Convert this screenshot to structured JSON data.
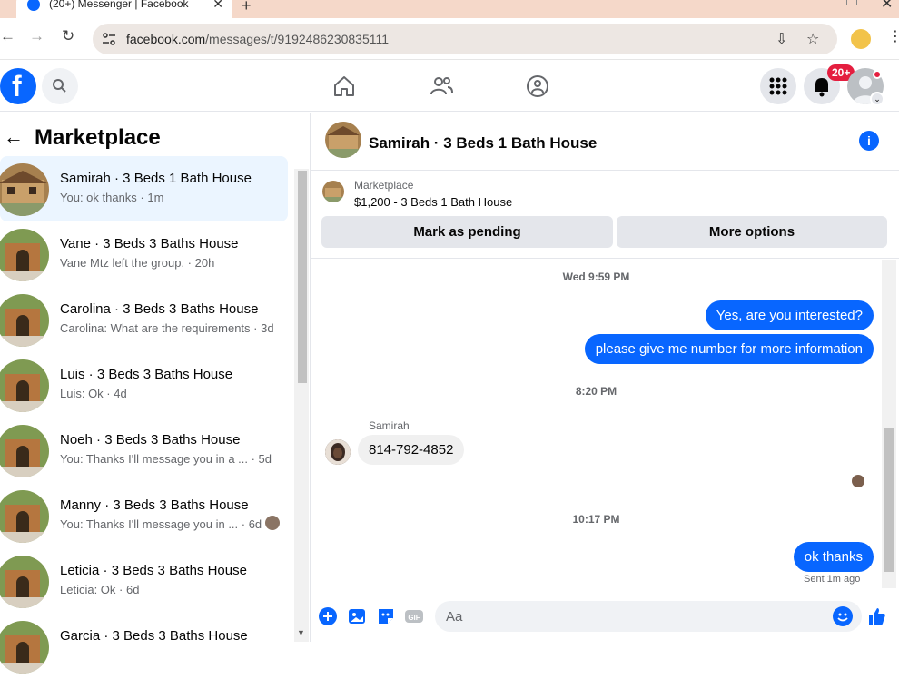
{
  "browser": {
    "tab_title": "(20+) Messenger | Facebook",
    "url_domain": "facebook.com",
    "url_path": "/messages/t/9192486230835111"
  },
  "header": {
    "notification_badge": "20+"
  },
  "sidebar": {
    "title": "Marketplace",
    "conversations": [
      {
        "name": "Samirah · 3 Beds 1 Bath House",
        "snippet": "You: ok thanks · 1m",
        "active": true
      },
      {
        "name": "Vane · 3 Beds 3 Baths House",
        "snippet": "Vane Mtz left the group. · 20h"
      },
      {
        "name": "Carolina · 3 Beds 3 Baths House",
        "snippet": "Carolina: What are the requirements · 3d"
      },
      {
        "name": "Luis · 3 Beds 3 Baths House",
        "snippet": "Luis: Ok · 4d"
      },
      {
        "name": "Noeh · 3 Beds 3 Baths House",
        "snippet": "You: Thanks I'll message you in a ...   · 5d"
      },
      {
        "name": "Manny · 3 Beds 3 Baths House",
        "snippet": "You: Thanks I'll message you in ...  · 6d"
      },
      {
        "name": "Leticia · 3 Beds 3 Baths House",
        "snippet": "Leticia: Ok · 6d"
      },
      {
        "name": "Garcia · 3 Beds 3 Baths House",
        "snippet": ""
      }
    ]
  },
  "chat": {
    "title": "Samirah · 3 Beds 1 Bath House",
    "marketplace_label": "Marketplace",
    "listing": "$1,200 - 3 Beds 1 Bath House",
    "mark_pending_label": "Mark as pending",
    "more_options_label": "More options",
    "timestamps": [
      "Wed 9:59 PM",
      "8:20 PM",
      "10:17 PM"
    ],
    "messages": {
      "out1": "Yes, are you interested?",
      "out2": "please give me number for more information",
      "sender": "Samirah",
      "in1": "814-792-4852",
      "out3": "ok thanks",
      "status": "Sent 1m ago"
    },
    "composer_placeholder": "Aa"
  },
  "colors": {
    "brand": "#0866ff",
    "active_row": "#ebf5ff",
    "badge": "#e41e3f"
  }
}
